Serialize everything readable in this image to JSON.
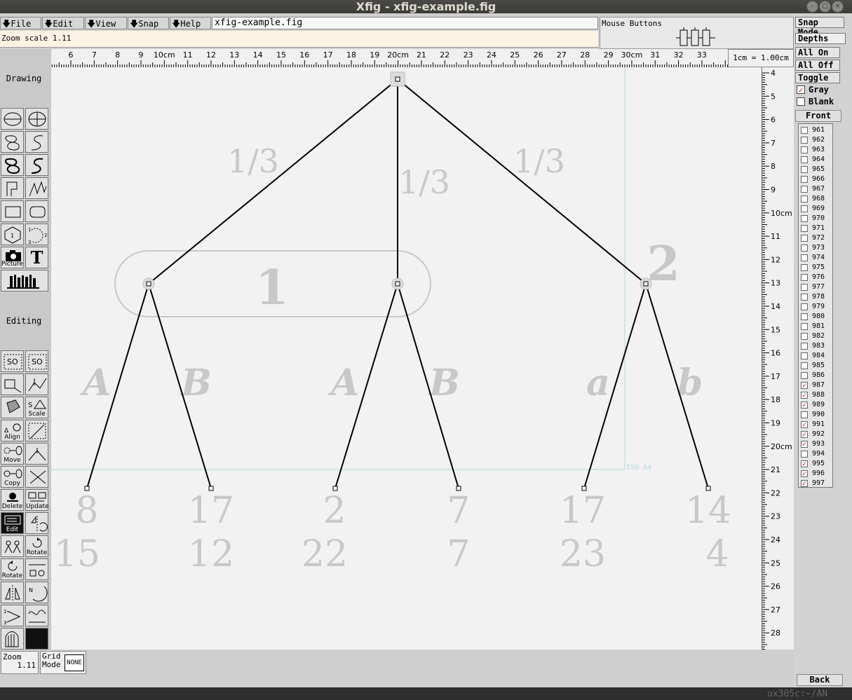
{
  "window": {
    "title": "Xfig - xfig-example.fig"
  },
  "menu": [
    {
      "label": "File",
      "icon": "down-arrow-icon"
    },
    {
      "label": "Edit",
      "icon": "down-arrow-icon"
    },
    {
      "label": "View",
      "icon": "down-arrow-icon"
    },
    {
      "label": "Snap",
      "icon": "down-arrow-icon"
    },
    {
      "label": "Help",
      "icon": "down-arrow-icon"
    }
  ],
  "filename": "xfig-example.fig",
  "zoom_scale": "Zoom scale  1.11",
  "mouse_buttons": {
    "label": "Mouse Buttons"
  },
  "units_label": "1cm = 1.00cm",
  "top_ruler": {
    "ticks": [
      "6",
      "7",
      "8",
      "9",
      "10cm",
      "11",
      "12",
      "13",
      "14",
      "15",
      "16",
      "17",
      "18",
      "19",
      "20cm",
      "21",
      "22",
      "23",
      "24",
      "25",
      "26",
      "27",
      "28",
      "29",
      "30cm",
      "31",
      "32",
      "33"
    ]
  },
  "right_ruler": {
    "ticks": [
      "4",
      "5",
      "6",
      "7",
      "8",
      "9",
      "10cm",
      "11",
      "12",
      "13",
      "14",
      "15",
      "16",
      "17",
      "18",
      "19",
      "20cm",
      "21",
      "22",
      "23",
      "24",
      "25",
      "26",
      "27",
      "28"
    ]
  },
  "modes": {
    "drawing": "Drawing",
    "editing": "Editing"
  },
  "tool_labels": {
    "picture": "Picture",
    "text_tool": "T",
    "scale": "Scale",
    "align": "Align",
    "move": "Move",
    "copy": "Copy",
    "delete": "Delete",
    "update": "Update",
    "edit": "Edit",
    "rotate_ccw": "Rotate",
    "rotate_cw": "Rotate"
  },
  "canvas": {
    "paper_label": "ISO A4",
    "probabilities": [
      "1/3",
      "1/3",
      "1/3"
    ],
    "players": [
      "1",
      "2"
    ],
    "actions": [
      "A",
      "B",
      "A",
      "B",
      "a",
      "b"
    ],
    "payoffs_top": [
      "8",
      "17",
      "2",
      "7",
      "17",
      "14"
    ],
    "payoffs_bottom": [
      "15",
      "12",
      "22",
      "7",
      "23",
      "4"
    ]
  },
  "status": {
    "zoom_label": "Zoom",
    "zoom_value": "1.11",
    "grid_label": "Grid Mode",
    "grid_value": "NONE"
  },
  "right_panel": {
    "snap_mode": "Snap Mode",
    "depths": "Depths",
    "all_on": "All On",
    "all_off": "All Off",
    "toggle": "Toggle",
    "gray": {
      "label": "Gray",
      "checked": true
    },
    "blank": {
      "label": "Blank",
      "checked": false
    },
    "front": "Front",
    "back": "Back",
    "depth_list": [
      {
        "d": "961",
        "c": false
      },
      {
        "d": "962",
        "c": false
      },
      {
        "d": "963",
        "c": false
      },
      {
        "d": "964",
        "c": false
      },
      {
        "d": "965",
        "c": false
      },
      {
        "d": "966",
        "c": false
      },
      {
        "d": "967",
        "c": false
      },
      {
        "d": "968",
        "c": false
      },
      {
        "d": "969",
        "c": false
      },
      {
        "d": "970",
        "c": false
      },
      {
        "d": "971",
        "c": false
      },
      {
        "d": "972",
        "c": false
      },
      {
        "d": "973",
        "c": false
      },
      {
        "d": "974",
        "c": false
      },
      {
        "d": "975",
        "c": false
      },
      {
        "d": "976",
        "c": false
      },
      {
        "d": "977",
        "c": false
      },
      {
        "d": "978",
        "c": false
      },
      {
        "d": "979",
        "c": false
      },
      {
        "d": "980",
        "c": false
      },
      {
        "d": "981",
        "c": false
      },
      {
        "d": "982",
        "c": false
      },
      {
        "d": "983",
        "c": false
      },
      {
        "d": "984",
        "c": false
      },
      {
        "d": "985",
        "c": false
      },
      {
        "d": "986",
        "c": false
      },
      {
        "d": "987",
        "c": true
      },
      {
        "d": "988",
        "c": true
      },
      {
        "d": "989",
        "c": true
      },
      {
        "d": "990",
        "c": false
      },
      {
        "d": "991",
        "c": true
      },
      {
        "d": "992",
        "c": true
      },
      {
        "d": "993",
        "c": true
      },
      {
        "d": "994",
        "c": false
      },
      {
        "d": "995",
        "c": true
      },
      {
        "d": "996",
        "c": true
      },
      {
        "d": "997",
        "c": true
      }
    ]
  },
  "desktop_fragment": "ux305c:~/AN",
  "colors": {
    "canvas": "#f2f2f2",
    "figure_text": "#c8c8c8",
    "check": "#dd0000"
  }
}
